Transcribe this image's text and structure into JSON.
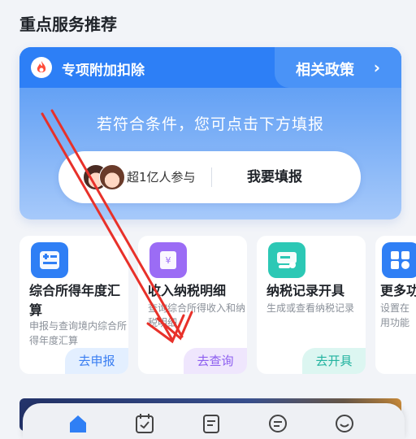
{
  "section": {
    "title": "重点服务推荐"
  },
  "feature": {
    "title": "专项附加扣除",
    "policy_label": "相关政策",
    "policy_chevron": "›",
    "subtitle": "若符合条件，您可点击下方填报",
    "participants": "超1亿人参与",
    "fill_button": "我要填报",
    "colors": {
      "header": "#2d7ff6",
      "accent": "#ff4d3a"
    },
    "icon": "fire-icon"
  },
  "services": [
    {
      "name": "综合所得年度汇算",
      "desc": "申报与查询境内综合所得年度汇算",
      "action": "去申报",
      "icon": "calculator-icon"
    },
    {
      "name": "收入纳税明细",
      "desc": "查询综合所得收入和纳税明细",
      "action": "去查询",
      "icon": "receipt-icon"
    },
    {
      "name": "纳税记录开具",
      "desc": "生成或查看纳税记录",
      "action": "去开具",
      "icon": "certificate-icon"
    },
    {
      "name": "更多功能",
      "desc": "设置在用功能",
      "action": "",
      "icon": "grid-icon"
    }
  ],
  "nav": {
    "items": [
      {
        "icon": "home-icon",
        "active": true
      },
      {
        "icon": "calendar-icon",
        "active": false
      },
      {
        "icon": "document-icon",
        "active": false
      },
      {
        "icon": "message-icon",
        "active": false
      },
      {
        "icon": "user-icon",
        "active": false
      }
    ]
  },
  "annotation": {
    "color": "#e8312a"
  }
}
